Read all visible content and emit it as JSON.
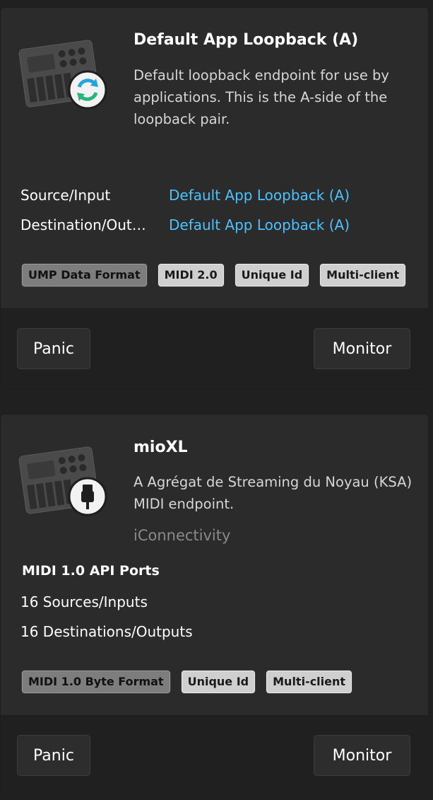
{
  "endpoints": [
    {
      "icon": "piano-loopback-icon",
      "title": "Default App Loopback (A)",
      "description": "Default loopback endpoint for use by applications. This is the A-side of the loopback pair.",
      "connections": [
        {
          "label": "Source/Input",
          "value": "Default App Loopback (A)"
        },
        {
          "label": "Destination/Output",
          "value": "Default App Loopback (A)"
        }
      ],
      "badges": [
        "UMP Data Format",
        "MIDI 2.0",
        "Unique Id",
        "Multi-client"
      ],
      "panic_label": "Panic",
      "monitor_label": "Monitor"
    },
    {
      "icon": "piano-usb-icon",
      "title": "mioXL",
      "description": "A Agrégat de Streaming du Noyau (KSA) MIDI endpoint.",
      "manufacturer": "iConnectivity",
      "ports_heading": "MIDI 1.0 API Ports",
      "sources": "16 Sources/Inputs",
      "destinations": "16 Destinations/Outputs",
      "badges": [
        "MIDI 1.0 Byte Format",
        "Unique Id",
        "Multi-client"
      ],
      "panic_label": "Panic",
      "monitor_label": "Monitor"
    }
  ]
}
